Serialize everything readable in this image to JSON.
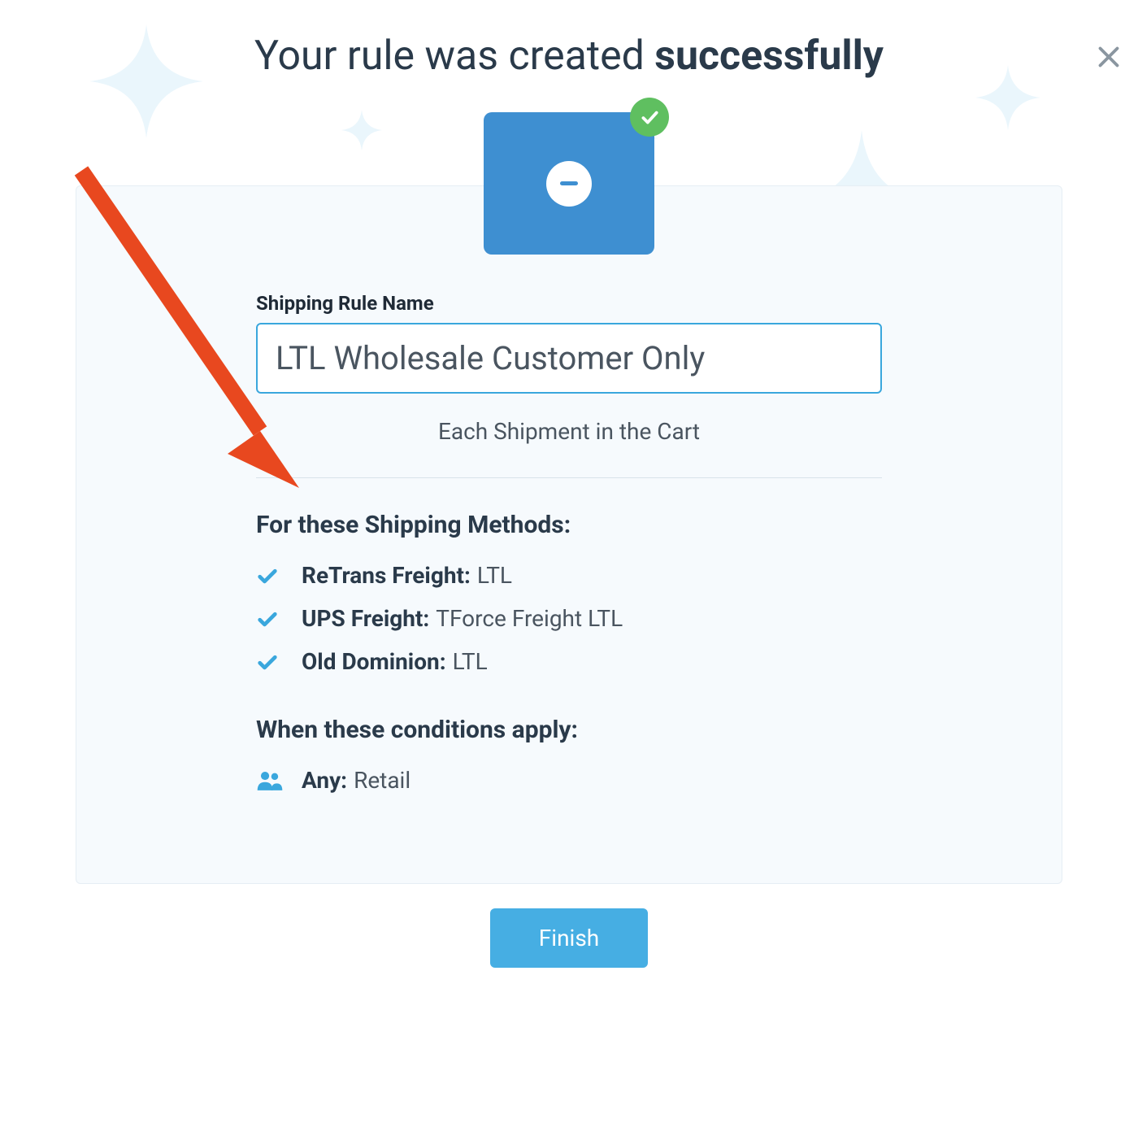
{
  "heading": {
    "prefix": "Your rule was created ",
    "strong": "successfully"
  },
  "rule": {
    "field_label": "Shipping Rule Name",
    "name_value": "LTL Wholesale Customer Only",
    "subtitle": "Each Shipment in the Cart"
  },
  "methods": {
    "heading": "For these Shipping Methods:",
    "items": [
      {
        "carrier": "ReTrans Freight:",
        "service": "LTL"
      },
      {
        "carrier": "UPS Freight:",
        "service": "TForce Freight LTL"
      },
      {
        "carrier": "Old Dominion:",
        "service": "LTL"
      }
    ]
  },
  "conditions": {
    "heading": "When these conditions apply:",
    "items": [
      {
        "label": "Any:",
        "value": "Retail"
      }
    ]
  },
  "buttons": {
    "finish": "Finish"
  }
}
